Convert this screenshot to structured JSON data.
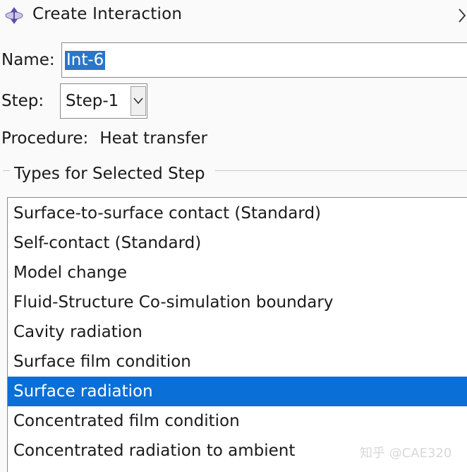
{
  "dialog": {
    "title": "Create Interaction",
    "icon": "abaqus-interaction-icon"
  },
  "name_field": {
    "label": "Name:",
    "value": "Int-6"
  },
  "step_field": {
    "label": "Step:",
    "selected": "Step-1"
  },
  "procedure": {
    "label": "Procedure:",
    "value": "Heat transfer"
  },
  "types_group": {
    "title": "Types for Selected Step",
    "items": [
      {
        "label": "Surface-to-surface contact (Standard)",
        "selected": false
      },
      {
        "label": "Self-contact (Standard)",
        "selected": false
      },
      {
        "label": "Model change",
        "selected": false
      },
      {
        "label": "Fluid-Structure Co-simulation boundary",
        "selected": false
      },
      {
        "label": "Cavity radiation",
        "selected": false
      },
      {
        "label": "Surface film condition",
        "selected": false
      },
      {
        "label": "Surface radiation",
        "selected": true
      },
      {
        "label": "Concentrated film condition",
        "selected": false
      },
      {
        "label": "Concentrated radiation to ambient",
        "selected": false
      }
    ]
  },
  "watermark": {
    "text": "知乎 @CAE320"
  },
  "colors": {
    "selection": "#0a6fd6",
    "name_highlight": "#2a76c9",
    "icon_purple": "#5a4fa3"
  }
}
